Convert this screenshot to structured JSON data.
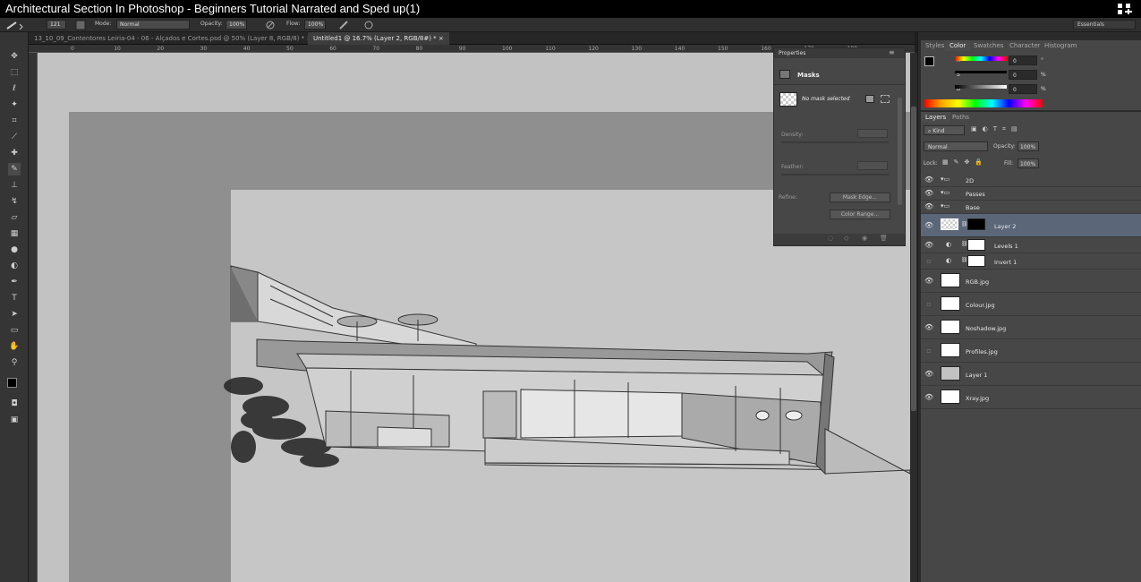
{
  "window": {
    "title": "Architectural Section In Photoshop - Beginners Tutorial Narrated and Sped up(1)"
  },
  "options_bar": {
    "brush_size": "121",
    "mode_label": "Mode:",
    "mode_value": "Normal",
    "opacity_label": "Opacity:",
    "opacity_value": "100%",
    "flow_label": "Flow:",
    "flow_value": "100%",
    "workspace": "Essentials"
  },
  "tabs": [
    {
      "label": "13_10_09_Contentores Leiria-04 - 06 - Alçados e Cortes.psd @ 50% (Layer 8, RGB/8) *",
      "active": false
    },
    {
      "label": "Untitled1 @ 16.7% (Layer 2, RGB/8#) *",
      "active": true
    }
  ],
  "ruler_ticks": [
    "0",
    "10",
    "20",
    "30",
    "40",
    "50",
    "60",
    "70",
    "80",
    "90",
    "100",
    "110",
    "120",
    "130",
    "140",
    "150",
    "160",
    "170",
    "180"
  ],
  "properties": {
    "tab": "Properties",
    "section": "Masks",
    "mask_status": "No mask selected",
    "density_label": "Density:",
    "feather_label": "Feather:",
    "refine_label": "Refine:",
    "mask_edge_button": "Mask Edge...",
    "color_range_button": "Color Range..."
  },
  "color_panel": {
    "tabs": [
      "Styles",
      "Color",
      "Swatches",
      "Character",
      "Histogram"
    ],
    "active_tab": "Color",
    "sliders": [
      {
        "label": "H",
        "value": "0",
        "unit": "°"
      },
      {
        "label": "S",
        "value": "0",
        "unit": "%"
      },
      {
        "label": "B",
        "value": "0",
        "unit": "%"
      }
    ]
  },
  "layers_panel": {
    "tabs": [
      "Layers",
      "Paths"
    ],
    "active_tab": "Layers",
    "filter_kind": "Kind",
    "blend_mode": "Normal",
    "opacity_label": "Opacity:",
    "opacity_value": "100%",
    "lock_label": "Lock:",
    "fill_label": "Fill:",
    "fill_value": "100%",
    "groups": [
      "2D",
      "Passes",
      "Base"
    ],
    "layers": [
      {
        "name": "Layer 2",
        "selected": true,
        "visible": true
      },
      {
        "name": "Levels 1",
        "visible": true
      },
      {
        "name": "Invert 1",
        "visible": false
      },
      {
        "name": "RGB.jpg",
        "visible": true
      },
      {
        "name": "Colour.jpg",
        "visible": false
      },
      {
        "name": "Noshadow.jpg",
        "visible": true
      },
      {
        "name": "Profiles.jpg",
        "visible": false
      },
      {
        "name": "Layer 1",
        "visible": true
      },
      {
        "name": "Xray.jpg",
        "visible": true
      }
    ]
  },
  "colors": {
    "accent_selected": "#5b6779",
    "panel_bg": "#474747",
    "canvas_bg": "#c2c2c2"
  }
}
